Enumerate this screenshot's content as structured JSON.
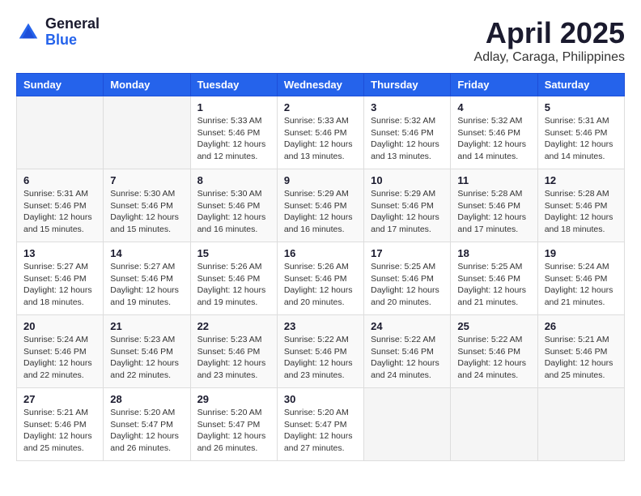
{
  "logo": {
    "general": "General",
    "blue": "Blue"
  },
  "title": "April 2025",
  "location": "Adlay, Caraga, Philippines",
  "weekdays": [
    "Sunday",
    "Monday",
    "Tuesday",
    "Wednesday",
    "Thursday",
    "Friday",
    "Saturday"
  ],
  "weeks": [
    [
      {
        "day": "",
        "info": ""
      },
      {
        "day": "",
        "info": ""
      },
      {
        "day": "1",
        "info": "Sunrise: 5:33 AM\nSunset: 5:46 PM\nDaylight: 12 hours and 12 minutes."
      },
      {
        "day": "2",
        "info": "Sunrise: 5:33 AM\nSunset: 5:46 PM\nDaylight: 12 hours and 13 minutes."
      },
      {
        "day": "3",
        "info": "Sunrise: 5:32 AM\nSunset: 5:46 PM\nDaylight: 12 hours and 13 minutes."
      },
      {
        "day": "4",
        "info": "Sunrise: 5:32 AM\nSunset: 5:46 PM\nDaylight: 12 hours and 14 minutes."
      },
      {
        "day": "5",
        "info": "Sunrise: 5:31 AM\nSunset: 5:46 PM\nDaylight: 12 hours and 14 minutes."
      }
    ],
    [
      {
        "day": "6",
        "info": "Sunrise: 5:31 AM\nSunset: 5:46 PM\nDaylight: 12 hours and 15 minutes."
      },
      {
        "day": "7",
        "info": "Sunrise: 5:30 AM\nSunset: 5:46 PM\nDaylight: 12 hours and 15 minutes."
      },
      {
        "day": "8",
        "info": "Sunrise: 5:30 AM\nSunset: 5:46 PM\nDaylight: 12 hours and 16 minutes."
      },
      {
        "day": "9",
        "info": "Sunrise: 5:29 AM\nSunset: 5:46 PM\nDaylight: 12 hours and 16 minutes."
      },
      {
        "day": "10",
        "info": "Sunrise: 5:29 AM\nSunset: 5:46 PM\nDaylight: 12 hours and 17 minutes."
      },
      {
        "day": "11",
        "info": "Sunrise: 5:28 AM\nSunset: 5:46 PM\nDaylight: 12 hours and 17 minutes."
      },
      {
        "day": "12",
        "info": "Sunrise: 5:28 AM\nSunset: 5:46 PM\nDaylight: 12 hours and 18 minutes."
      }
    ],
    [
      {
        "day": "13",
        "info": "Sunrise: 5:27 AM\nSunset: 5:46 PM\nDaylight: 12 hours and 18 minutes."
      },
      {
        "day": "14",
        "info": "Sunrise: 5:27 AM\nSunset: 5:46 PM\nDaylight: 12 hours and 19 minutes."
      },
      {
        "day": "15",
        "info": "Sunrise: 5:26 AM\nSunset: 5:46 PM\nDaylight: 12 hours and 19 minutes."
      },
      {
        "day": "16",
        "info": "Sunrise: 5:26 AM\nSunset: 5:46 PM\nDaylight: 12 hours and 20 minutes."
      },
      {
        "day": "17",
        "info": "Sunrise: 5:25 AM\nSunset: 5:46 PM\nDaylight: 12 hours and 20 minutes."
      },
      {
        "day": "18",
        "info": "Sunrise: 5:25 AM\nSunset: 5:46 PM\nDaylight: 12 hours and 21 minutes."
      },
      {
        "day": "19",
        "info": "Sunrise: 5:24 AM\nSunset: 5:46 PM\nDaylight: 12 hours and 21 minutes."
      }
    ],
    [
      {
        "day": "20",
        "info": "Sunrise: 5:24 AM\nSunset: 5:46 PM\nDaylight: 12 hours and 22 minutes."
      },
      {
        "day": "21",
        "info": "Sunrise: 5:23 AM\nSunset: 5:46 PM\nDaylight: 12 hours and 22 minutes."
      },
      {
        "day": "22",
        "info": "Sunrise: 5:23 AM\nSunset: 5:46 PM\nDaylight: 12 hours and 23 minutes."
      },
      {
        "day": "23",
        "info": "Sunrise: 5:22 AM\nSunset: 5:46 PM\nDaylight: 12 hours and 23 minutes."
      },
      {
        "day": "24",
        "info": "Sunrise: 5:22 AM\nSunset: 5:46 PM\nDaylight: 12 hours and 24 minutes."
      },
      {
        "day": "25",
        "info": "Sunrise: 5:22 AM\nSunset: 5:46 PM\nDaylight: 12 hours and 24 minutes."
      },
      {
        "day": "26",
        "info": "Sunrise: 5:21 AM\nSunset: 5:46 PM\nDaylight: 12 hours and 25 minutes."
      }
    ],
    [
      {
        "day": "27",
        "info": "Sunrise: 5:21 AM\nSunset: 5:46 PM\nDaylight: 12 hours and 25 minutes."
      },
      {
        "day": "28",
        "info": "Sunrise: 5:20 AM\nSunset: 5:47 PM\nDaylight: 12 hours and 26 minutes."
      },
      {
        "day": "29",
        "info": "Sunrise: 5:20 AM\nSunset: 5:47 PM\nDaylight: 12 hours and 26 minutes."
      },
      {
        "day": "30",
        "info": "Sunrise: 5:20 AM\nSunset: 5:47 PM\nDaylight: 12 hours and 27 minutes."
      },
      {
        "day": "",
        "info": ""
      },
      {
        "day": "",
        "info": ""
      },
      {
        "day": "",
        "info": ""
      }
    ]
  ]
}
